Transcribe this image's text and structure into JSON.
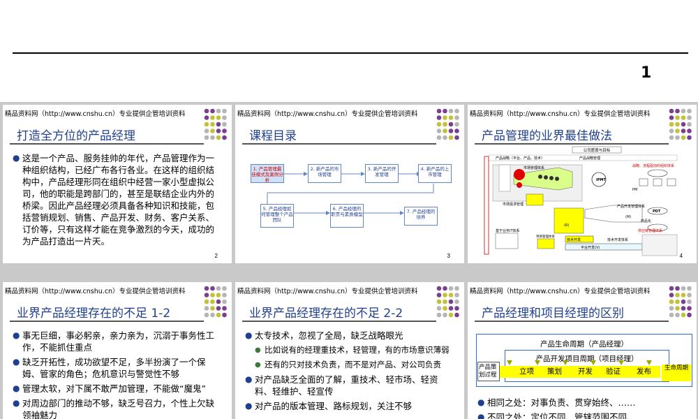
{
  "top": {
    "page_number": "1"
  },
  "header_text": "精品资料网（http://www.cnshu.cn）专业提供企管培训资料",
  "slides": [
    {
      "title": "打造全方位的产品经理",
      "page": "2",
      "bullets": [
        "这是一个产品、服务挂帅的年代，产品管理作为一种组织结构，已经广布各行各业。在这样的组织结构中，产品经理形同在组织中经营一家小型虚拟公司，他的职能是跨部门的，甚至是联结企业内外的桥梁。因此产品经理必须具备各种知识和技能，包括营销规划、销售、产品开发、财务、客户关系、订价等，只有这样才能在竞争激烈的今天，成功的为产品打造出一片天。"
      ]
    },
    {
      "title": "课程目录",
      "page": "3",
      "flow": [
        "1. 产品管理最佳模式及案例分析",
        "2. 新产品的市场管理",
        "3. 新产品的开发管理",
        "4. 新产品的上市管理",
        "5. 产品经理如何管理整个产品团队",
        "6. 产品经理的职责与素质模型",
        "7. 产品经理的培养"
      ]
    },
    {
      "title": "产品管理的业界最佳做法",
      "page": "4",
      "diagram": {
        "top_box": "公司愿景与目标",
        "strategy_left": "产品战略（平台、产品、技术）",
        "strategy_right": "产品战略管理",
        "strategy_note": "战略、流程驱动的组织体系",
        "market_mgmt": "市场管理体系",
        "market_req": "市场需求管理",
        "pdt": "PDT",
        "ipmt": "IPMT",
        "product_dev": "产品开发管理体系",
        "supply": "供应链管理体系",
        "tech_dev": "技术开发",
        "platform_dev": "平台开发(V)",
        "base_tools": "基于业务IT体系",
        "project_mgmt": "项目管理体系",
        "tech_mgmt": "技术开发体系",
        "commercial": "商品化",
        "label_m": "(M)",
        "label_r": "(R)",
        "label_pm": "PM"
      }
    },
    {
      "title": "业界产品经理存在的不足 1-2",
      "page": "",
      "bullets": [
        "事无巨细，事必躬亲，亲力亲为，沉溺于事务性工作，不能抓住重点",
        "缺乏开拓性，成功欲望不足，多半扮演了一个保姆、管家的角色；危机意识与警觉性不够",
        "管理太软，对下属不敢严加管理，不能做“魔鬼”",
        "对周边部门的推动不够，缺乏号召力，个性上欠缺领袖魅力"
      ]
    },
    {
      "title": "业界产品经理存在的不足 2-2",
      "page": "",
      "bullets": [
        {
          "text": "太专技术，忽视了全局，缺乏战略眼光",
          "level": 1
        },
        {
          "text": "比如说有的经理重技术，轻管理，有的市场意识薄弱",
          "level": 2
        },
        {
          "text": "还有的只对技术负责，而不是对产品、对公司负责",
          "level": 2
        },
        {
          "text": "对产品缺乏全面的了解，重技术、轻市场、轻资料、轻维护、轻宣传",
          "level": 1
        },
        {
          "text": "对产品的版本管理、路标规划，关注不够",
          "level": 1
        }
      ]
    },
    {
      "title": "产品经理和项目经理的区别",
      "page": "",
      "lifecycle": {
        "outer": "产品生命周期（产品经理）",
        "inner": "产品开发项目周期（项目经理）",
        "process": "产品策划过程",
        "stages": [
          "立项",
          "策划",
          "开发",
          "验证",
          "发布"
        ],
        "life": "生命周期"
      },
      "bullets": [
        "相同之处：对事负责、贯穿始终、……",
        "不同之处：定位不同、管辖范围不同、……"
      ]
    }
  ],
  "colors": {
    "title_blue": "#1f3f8f",
    "dot_purple": "#7b3f8f",
    "dot_green": "#c2c23a",
    "dot_gray": "#b5b5b5",
    "grid_gray": "#c9c9c9",
    "highlight_yellow": "#ffff00"
  }
}
